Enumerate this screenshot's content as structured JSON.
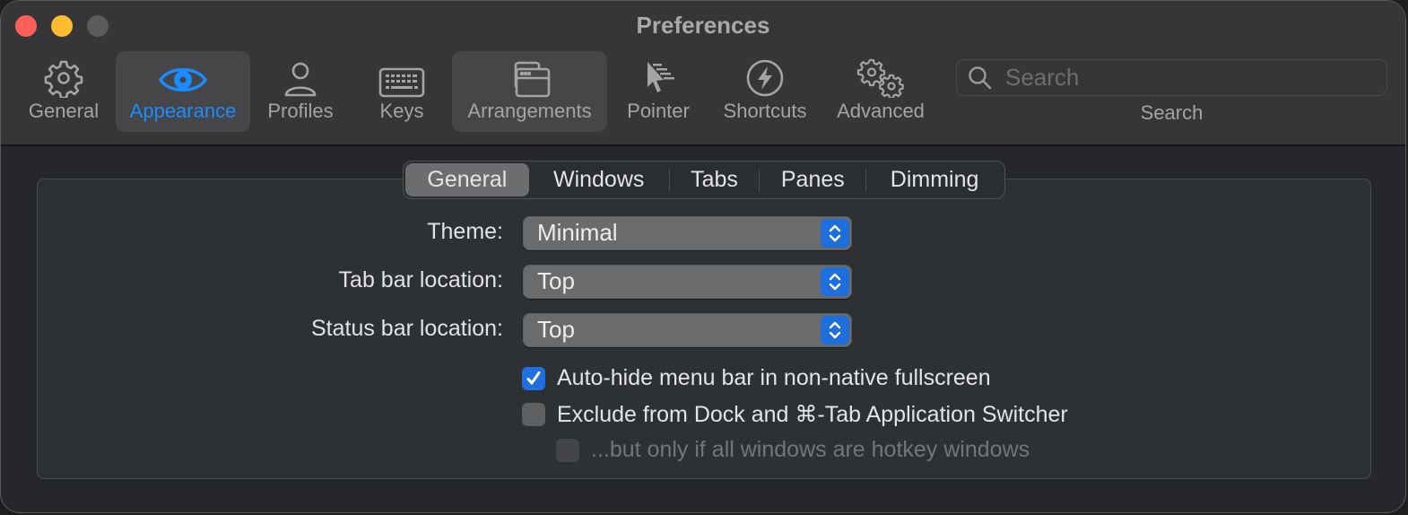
{
  "window": {
    "title": "Preferences"
  },
  "toolbar": {
    "items": [
      {
        "id": "general",
        "label": "General",
        "icon": "gear-icon",
        "active": false
      },
      {
        "id": "appearance",
        "label": "Appearance",
        "icon": "eye-icon",
        "active": true
      },
      {
        "id": "profiles",
        "label": "Profiles",
        "icon": "person-icon",
        "active": false
      },
      {
        "id": "keys",
        "label": "Keys",
        "icon": "keyboard-icon",
        "active": false
      },
      {
        "id": "arrangements",
        "label": "Arrangements",
        "icon": "windows-icon",
        "active": false
      },
      {
        "id": "pointer",
        "label": "Pointer",
        "icon": "pointer-icon",
        "active": false
      },
      {
        "id": "shortcuts",
        "label": "Shortcuts",
        "icon": "lightning-icon",
        "active": false
      },
      {
        "id": "advanced",
        "label": "Advanced",
        "icon": "gears-icon",
        "active": false
      }
    ],
    "search": {
      "placeholder": "Search",
      "value": "",
      "label": "Search"
    }
  },
  "colors": {
    "accent": "#1a8cff",
    "checkbox_on": "#1f6fe0"
  },
  "tabs": [
    {
      "label": "General",
      "active": true
    },
    {
      "label": "Windows",
      "active": false
    },
    {
      "label": "Tabs",
      "active": false
    },
    {
      "label": "Panes",
      "active": false
    },
    {
      "label": "Dimming",
      "active": false
    }
  ],
  "settings": {
    "theme": {
      "label": "Theme:",
      "value": "Minimal"
    },
    "tab_bar_location": {
      "label": "Tab bar location:",
      "value": "Top"
    },
    "status_bar_location": {
      "label": "Status bar location:",
      "value": "Top"
    },
    "checkboxes": [
      {
        "label": "Auto-hide menu bar in non-native fullscreen",
        "checked": true,
        "enabled": true
      },
      {
        "label": "Exclude from Dock and ⌘-Tab Application Switcher",
        "checked": false,
        "enabled": true
      },
      {
        "label": "...but only if all windows are hotkey windows",
        "checked": false,
        "enabled": false
      }
    ]
  }
}
